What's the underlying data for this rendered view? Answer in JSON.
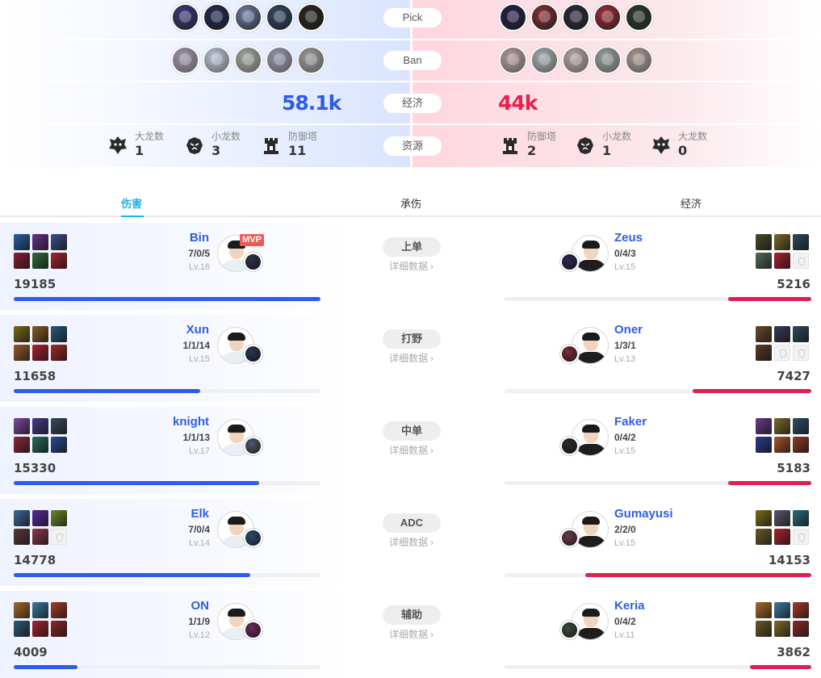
{
  "compare": {
    "pick_label": "Pick",
    "ban_label": "Ban",
    "gold_label": "经济",
    "resource_label": "资源",
    "blue": {
      "gold": "58.1k",
      "picks": [
        "#3d3b7a",
        "#232a52",
        "#6f83a6",
        "#324a68",
        "#2a2622"
      ],
      "bans": [
        "#8e6e93",
        "#a3b6d4",
        "#8a8f66",
        "#7a7397",
        "#8a7b69"
      ],
      "objectives": [
        {
          "label": "大龙数",
          "value": "1",
          "icon": "baron-icon"
        },
        {
          "label": "小龙数",
          "value": "3",
          "icon": "dragon-icon"
        },
        {
          "label": "防御塔",
          "value": "11",
          "icon": "tower-icon"
        }
      ]
    },
    "red": {
      "gold": "44k",
      "picks": [
        "#25204a",
        "#8c2e3b",
        "#2b2a40",
        "#a02e3a",
        "#2e3a2e"
      ],
      "bans": [
        "#9b8389",
        "#6fa0a0",
        "#a88c8a",
        "#5f8a7a",
        "#8f7a68"
      ],
      "objectives": [
        {
          "label": "防御塔",
          "value": "2",
          "icon": "tower-icon"
        },
        {
          "label": "小龙数",
          "value": "1",
          "icon": "dragon-icon"
        },
        {
          "label": "大龙数",
          "value": "0",
          "icon": "baron-icon"
        }
      ]
    }
  },
  "tabs": [
    {
      "label": "伤害",
      "active": true
    },
    {
      "label": "承伤",
      "active": false
    },
    {
      "label": "经济",
      "active": false
    }
  ],
  "detail_label": "详细数据",
  "mvp_label": "MVP",
  "colors": {
    "blue_bar": "#2f5de8",
    "red_bar": "#e0204f",
    "blue_text": "#2f5de8"
  },
  "players": [
    {
      "role": "上单",
      "blue": {
        "name": "Bin",
        "kda": "7/0/5",
        "level": "Lv.16",
        "value": "19185",
        "fill": 1.0,
        "mvp": true,
        "champ": "#2d2f48",
        "shirt": "#e9eef3",
        "items": [
          "#2b5fa8",
          "#6b2f8a",
          "#3b4f8a",
          "#8a2030",
          "#2e6e3a",
          "#a8242f"
        ]
      },
      "red": {
        "name": "Zeus",
        "kda": "0/4/3",
        "level": "Lv.15",
        "value": "5216",
        "fill": 0.272,
        "mvp": false,
        "champ": "#2c2650",
        "shirt": "#1e1e1e",
        "items": [
          "#4a4a2a",
          "#7a6a2a",
          "#2f4b5a",
          "#556a56",
          "#a8242f",
          "empty"
        ]
      }
    },
    {
      "role": "打野",
      "blue": {
        "name": "Xun",
        "kda": "1/1/14",
        "level": "Lv.15",
        "value": "11658",
        "fill": 0.608,
        "mvp": false,
        "champ": "#283552",
        "shirt": "#e9eef3",
        "items": [
          "#7a6a1a",
          "#8a5a2a",
          "#2a5a7a",
          "#9a5a2a",
          "#a8242f",
          "#a02a2a"
        ]
      },
      "red": {
        "name": "Oner",
        "kda": "1/3/1",
        "level": "Lv.13",
        "value": "7427",
        "fill": 0.387,
        "mvp": false,
        "champ": "#7a2a3a",
        "shirt": "#1e1e1e",
        "items": [
          "#6a4a2a",
          "#3a3a5a",
          "#2f4b5a",
          "#5a3a2a",
          "empty",
          "empty"
        ]
      }
    },
    {
      "role": "中单",
      "blue": {
        "name": "knight",
        "kda": "1/1/13",
        "level": "Lv.17",
        "value": "15330",
        "fill": 0.799,
        "mvp": false,
        "champ": "#505a72",
        "shirt": "#e9eef3",
        "items": [
          "#7a4aa0",
          "#4a3a8a",
          "#3a4a5a",
          "#8a2a3a",
          "#2a6a5a",
          "#2a4a8a"
        ]
      },
      "red": {
        "name": "Faker",
        "kda": "0/4/2",
        "level": "Lv.15",
        "value": "5183",
        "fill": 0.27,
        "mvp": false,
        "champ": "#2a2a2a",
        "shirt": "#1e1e1e",
        "items": [
          "#6a3a8a",
          "#7a6a2a",
          "#2f4b6a",
          "#2a3a8a",
          "#a8542a",
          "#8a3a2a"
        ]
      }
    },
    {
      "role": "ADC",
      "blue": {
        "name": "Elk",
        "kda": "7/0/4",
        "level": "Lv.14",
        "value": "14778",
        "fill": 0.77,
        "mvp": false,
        "champ": "#2a4a6a",
        "shirt": "#e9eef3",
        "items": [
          "#3a6a9a",
          "#5a2a9a",
          "#6a8a2a",
          "#5a3a3a",
          "#8a3a4a",
          "empty"
        ]
      },
      "red": {
        "name": "Gumayusi",
        "kda": "2/2/0",
        "level": "Lv.15",
        "value": "14153",
        "fill": 0.738,
        "mvp": false,
        "champ": "#6a3a4a",
        "shirt": "#1e1e1e",
        "items": [
          "#7a6a1a",
          "#5a5a6a",
          "#2a6a7a",
          "#6a5a2a",
          "#a8242f",
          "empty"
        ]
      }
    },
    {
      "role": "辅助",
      "blue": {
        "name": "ON",
        "kda": "1/1/9",
        "level": "Lv.12",
        "value": "4009",
        "fill": 0.209,
        "mvp": false,
        "champ": "#6a2a5a",
        "shirt": "#e9eef3",
        "items": [
          "#a86a2a",
          "#3a7a9a",
          "#a83a2a",
          "#2a5a7a",
          "#a8242f",
          "#8a2a2a"
        ]
      },
      "red": {
        "name": "Keria",
        "kda": "0/4/2",
        "level": "Lv.11",
        "value": "3862",
        "fill": 0.201,
        "mvp": false,
        "champ": "#3a4a3a",
        "shirt": "#1e1e1e",
        "items": [
          "#a86a2a",
          "#3a7a9a",
          "#a83a2a",
          "#6a5a2a",
          "#7a6a2a",
          "#8a2a2a"
        ]
      }
    }
  ]
}
